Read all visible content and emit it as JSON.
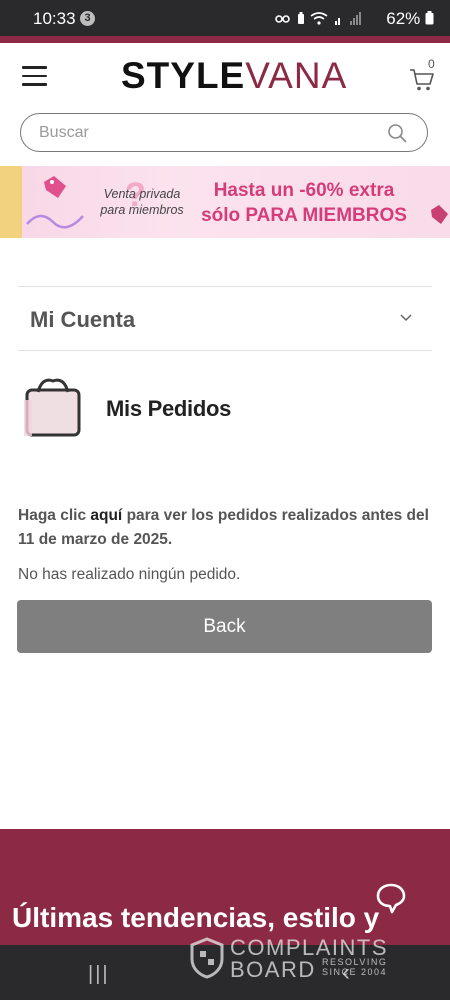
{
  "status_bar": {
    "time": "10:33",
    "notification_count": "3",
    "battery": "62%"
  },
  "header": {
    "logo_part1": "STYLE",
    "logo_part2": "VANA",
    "cart_count": "0"
  },
  "search": {
    "placeholder": "Buscar"
  },
  "banner": {
    "small_text": "Venta privada para miembros",
    "big_text": "Hasta un -60% extra sólo PARA MIEMBROS"
  },
  "account": {
    "title": "Mi Cuenta"
  },
  "orders": {
    "title": "Mis Pedidos",
    "info_prefix": "Haga clic",
    "info_link": "aquí",
    "info_suffix": "para ver los pedidos realizados antes del 11 de marzo de 2025.",
    "empty_message": "No has realizado ningún pedido.",
    "back_label": "Back"
  },
  "footer": {
    "tagline": "Últimas tendencias, estilo y"
  },
  "watermark": {
    "line1": "COMPLAINTS",
    "line2": "BOARD",
    "line3": "RESOLVING SINCE 2004"
  },
  "colors": {
    "brand": "#8c2a45",
    "button": "#7f7f7f",
    "banner_text": "#d63c7a"
  }
}
